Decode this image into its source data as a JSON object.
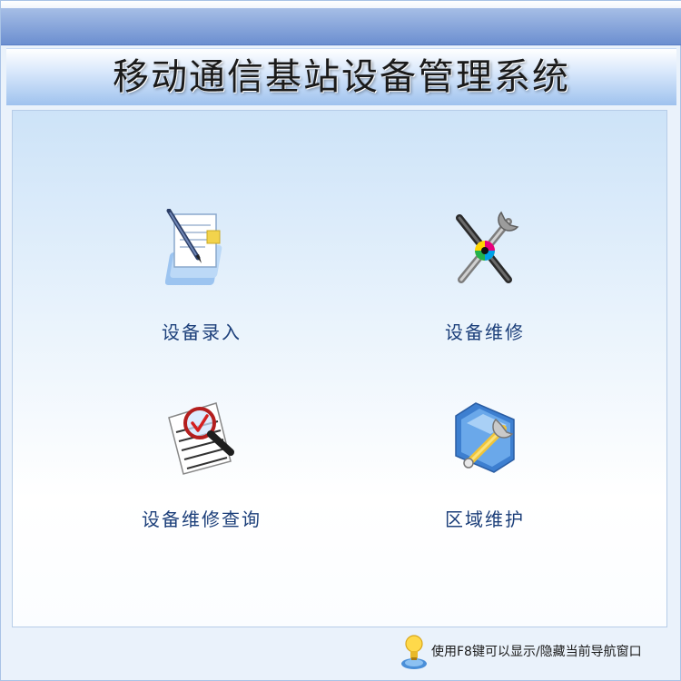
{
  "header": {
    "title": "移动通信基站设备管理系统"
  },
  "nav": {
    "items": [
      {
        "label": "设备录入",
        "icon": "document-pen-icon"
      },
      {
        "label": "设备维修",
        "icon": "wrench-screwdriver-icon"
      },
      {
        "label": "设备维修查询",
        "icon": "magnifier-checklist-icon"
      },
      {
        "label": "区域维护",
        "icon": "folder-wrench-icon"
      }
    ]
  },
  "footer": {
    "hint": "使用F8键可以显示/隐藏当前导航窗口",
    "icon": "lightbulb-user-icon"
  },
  "colors": {
    "title_band": "#9fc2ee",
    "label_text": "#1c3f7a",
    "top_bar": "#6c8fd0"
  }
}
